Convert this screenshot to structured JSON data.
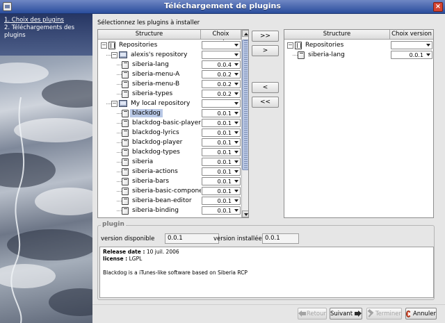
{
  "window": {
    "title": "Téléchargement de plugins"
  },
  "sidebar": {
    "steps": [
      {
        "label": "1. Choix des plugins",
        "current": true
      },
      {
        "label": "2. Téléchargements des plugins",
        "current": false
      }
    ]
  },
  "main": {
    "instruction": "Sélectionnez les plugins à installer",
    "available_table": {
      "columns": [
        "Structure",
        "Choix version"
      ],
      "rows": [
        {
          "depth": 0,
          "type": "root",
          "expander": "−",
          "label": "Repositories",
          "version": ""
        },
        {
          "depth": 1,
          "type": "repo",
          "expander": "−",
          "label": "alexis's repository",
          "version": ""
        },
        {
          "depth": 2,
          "type": "plugin",
          "label": "siberia-lang",
          "version": "0.0.4"
        },
        {
          "depth": 2,
          "type": "plugin",
          "label": "siberia-menu-A",
          "version": "0.0.2"
        },
        {
          "depth": 2,
          "type": "plugin",
          "label": "siberia-menu-B",
          "version": "0.0.2"
        },
        {
          "depth": 2,
          "type": "plugin",
          "label": "siberia-types",
          "version": "0.0.2"
        },
        {
          "depth": 1,
          "type": "repo",
          "expander": "−",
          "label": "My local repository",
          "version": ""
        },
        {
          "depth": 2,
          "type": "plugin",
          "label": "blackdog",
          "version": "0.0.1",
          "selected": true
        },
        {
          "depth": 2,
          "type": "plugin",
          "label": "blackdog-basic-player",
          "version": "0.0.1"
        },
        {
          "depth": 2,
          "type": "plugin",
          "label": "blackdog-lyrics",
          "version": "0.0.1"
        },
        {
          "depth": 2,
          "type": "plugin",
          "label": "blackdog-player",
          "version": "0.0.1"
        },
        {
          "depth": 2,
          "type": "plugin",
          "label": "blackdog-types",
          "version": "0.0.1"
        },
        {
          "depth": 2,
          "type": "plugin",
          "label": "siberia",
          "version": "0.0.1"
        },
        {
          "depth": 2,
          "type": "plugin",
          "label": "siberia-actions",
          "version": "0.0.1"
        },
        {
          "depth": 2,
          "type": "plugin",
          "label": "siberia-bars",
          "version": "0.0.1"
        },
        {
          "depth": 2,
          "type": "plugin",
          "label": "siberia-basic-componen",
          "version": "0.0.1"
        },
        {
          "depth": 2,
          "type": "plugin",
          "label": "siberia-bean-editor",
          "version": "0.0.1"
        },
        {
          "depth": 2,
          "type": "plugin",
          "label": "siberia-binding",
          "version": "0.0.1"
        }
      ]
    },
    "selected_table": {
      "columns": [
        "Structure",
        "Choix version"
      ],
      "rows": [
        {
          "depth": 0,
          "type": "root",
          "expander": "−",
          "label": "Repositories",
          "version": ""
        },
        {
          "depth": 1,
          "type": "plugin",
          "label": "siberia-lang",
          "version": "0.0.1"
        }
      ]
    },
    "move_buttons": {
      "add_all": ">>",
      "add": ">",
      "remove": "<",
      "remove_all": "<<"
    },
    "plugin_panel": {
      "legend": "plugin",
      "available_label": "version disponible",
      "available_value": "0.0.1",
      "installed_label": "version installée",
      "installed_value": "0.0.1",
      "release_label": "Release date :",
      "release_value": "10 juil. 2006",
      "license_label": "license :",
      "license_value": "LGPL",
      "description": "Blackdog is a iTunes-like software based on Siberia RCP"
    }
  },
  "footer": {
    "back": "Retour",
    "next": "Suivant",
    "finish": "Terminer",
    "cancel": "Annuler"
  }
}
